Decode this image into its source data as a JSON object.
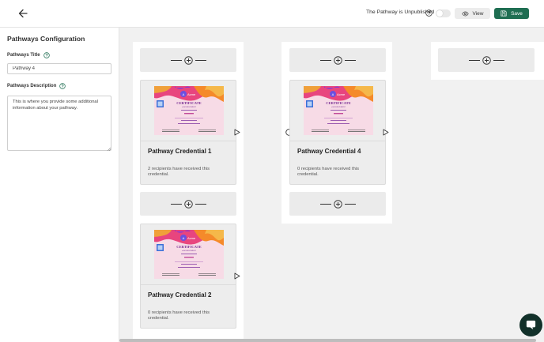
{
  "header": {
    "status_text": "The Pathway is Unpublished",
    "published": false,
    "view_label": "View",
    "save_label": "Save",
    "save_color": "#1f6e52"
  },
  "config": {
    "title": "Pathways Configuration",
    "pathway_title_label": "Pathways Title",
    "pathway_title_value": "Pathway 4",
    "description_label": "Pathways Description",
    "description_value": "This is where you provide some additional information about your pathway."
  },
  "certificate": {
    "logo_text": "Acme",
    "heading": "CERTIFICATE",
    "subheading": "of ACHIEVEMENT"
  },
  "credentials": [
    {
      "title": "Pathway Credential 1",
      "description": "2 recipients have received this credential."
    },
    {
      "title": "Pathway Credential 4",
      "description": "0 recipients have received this credential."
    },
    {
      "title": "Pathway Credential 2",
      "description": "0 recipients have received this credential."
    }
  ],
  "icons": {
    "back": "arrow-left-icon",
    "help": "question-circle-icon",
    "view": "eye-icon",
    "save": "floppy-disk-icon",
    "add": "plus-circle-icon",
    "connector": "play-triangle-icon",
    "chat": "chat-bubble-icon"
  }
}
